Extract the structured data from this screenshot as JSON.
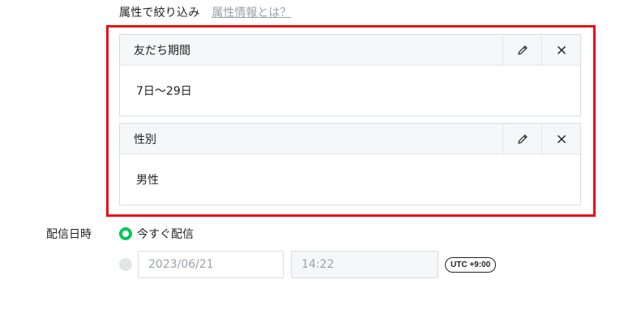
{
  "filter": {
    "title": "属性で絞り込み",
    "help_link": "属性情報とは？"
  },
  "cards": [
    {
      "title": "友だち期間",
      "value": "7日〜29日",
      "edit_icon": "pencil-icon",
      "remove_icon": "close-icon"
    },
    {
      "title": "性別",
      "value": "男性",
      "edit_icon": "pencil-icon",
      "remove_icon": "close-icon"
    }
  ],
  "schedule": {
    "label": "配信日時",
    "option_now": "今すぐ配信",
    "date_value": "2023/06/21",
    "time_value": "14:22",
    "timezone": "UTC +9:00"
  },
  "colors": {
    "highlight": "#e8101a",
    "radio_selected": "#06c755",
    "muted_text": "#9aa1aa"
  }
}
